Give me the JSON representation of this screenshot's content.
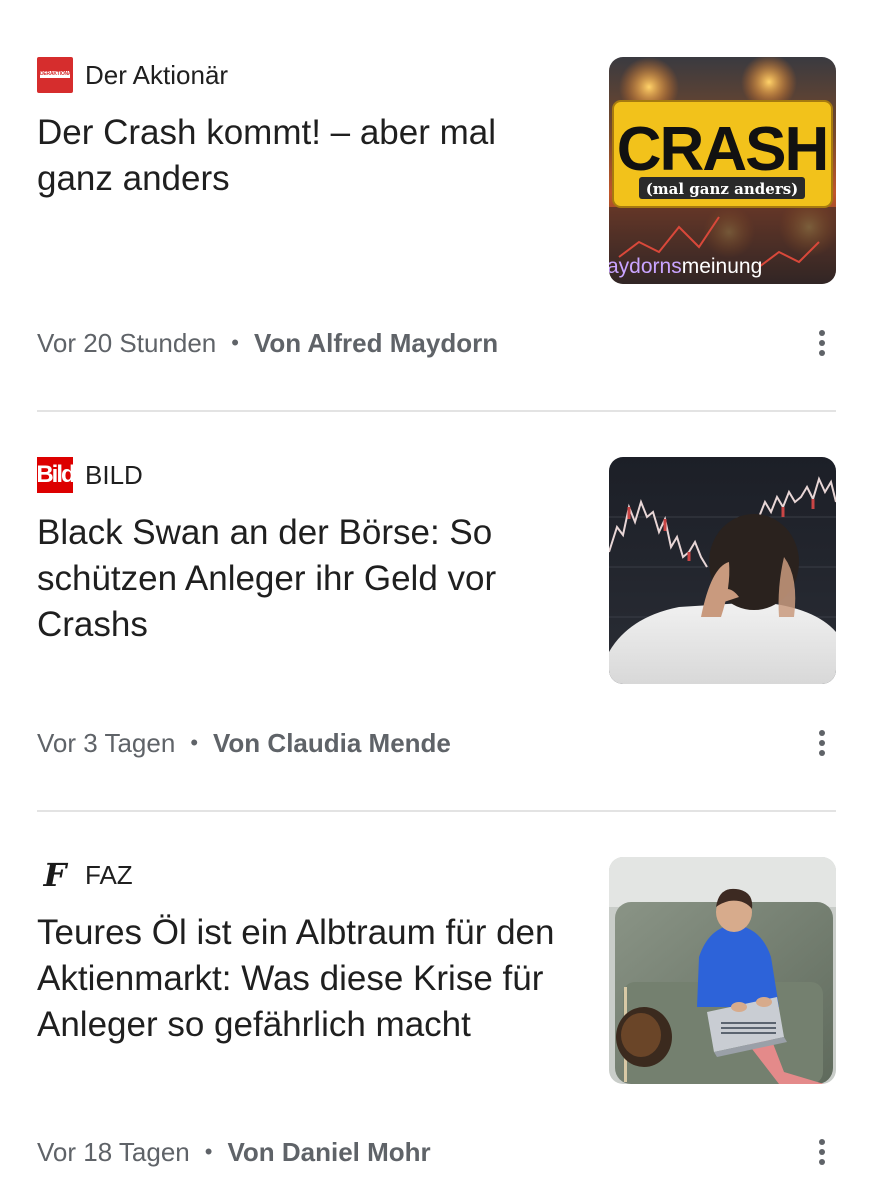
{
  "articles": [
    {
      "source": "Der Aktionär",
      "logo_text": "DERAKTIONAER.DE",
      "headline": "Der Crash kommt! – aber mal ganz anders",
      "time": "Vor 20 Stunden",
      "author": "Von Alfred Maydorn",
      "thumbnail": {
        "big_text": "CRASH",
        "sub_text": "(mal ganz anders)",
        "footer_text_a": "aydorns",
        "footer_text_b": "meinung"
      }
    },
    {
      "source": "BILD",
      "logo_text": "Bild",
      "headline": "Black Swan an der Börse: So schützen Anleger ihr Geld vor Crashs",
      "time": "Vor 3 Tagen",
      "author": "Von Claudia Mende"
    },
    {
      "source": "FAZ",
      "logo_text": "F",
      "headline": "Teures Öl ist ein Albtraum für den Aktienmarkt: Was diese Krise für Anleger so gefährlich macht",
      "time": "Vor 18 Tagen",
      "author": "Von Daniel Mohr"
    }
  ],
  "meta_separator": "•",
  "colors": {
    "text_primary": "#1f1f1f",
    "text_secondary": "#5f6368",
    "divider": "#e3e3e3",
    "aktionaer_red": "#d62d2d",
    "bild_red": "#dd0000",
    "crash_yellow": "#f2c21b"
  },
  "icons": {
    "more_menu": "more-vert-icon"
  }
}
